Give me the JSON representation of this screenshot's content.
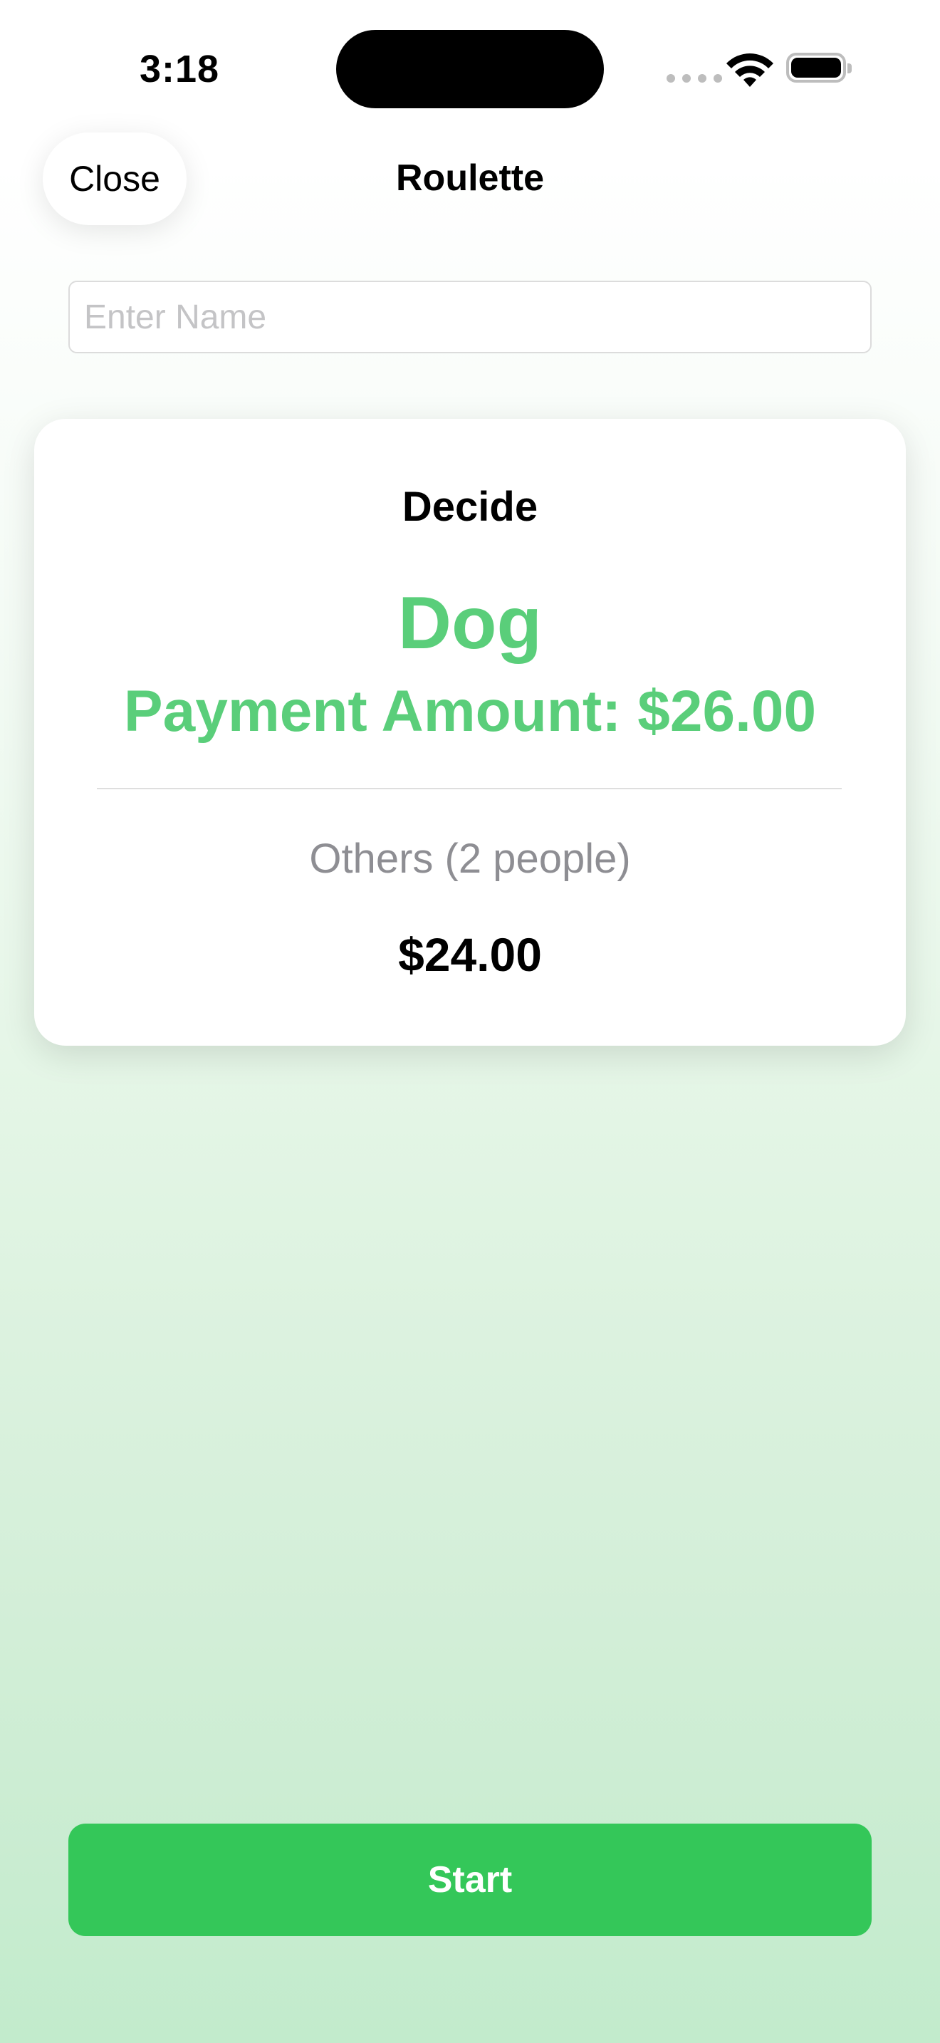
{
  "status_bar": {
    "time": "3:18"
  },
  "nav": {
    "close_label": "Close",
    "title": "Roulette"
  },
  "name_input": {
    "placeholder": "Enter Name",
    "value": ""
  },
  "result_card": {
    "title": "Decide",
    "winner_name": "Dog",
    "winner_payment": "Payment Amount: $26.00",
    "others_label": "Others (2 people)",
    "others_amount": "$24.00"
  },
  "actions": {
    "start_label": "Start"
  },
  "colors": {
    "accent_green": "#34c759",
    "winner_green": "#5ace7a",
    "secondary_gray": "#8e8e93"
  },
  "icons": [
    "cellular-signal-icon",
    "wifi-icon",
    "battery-icon"
  ]
}
